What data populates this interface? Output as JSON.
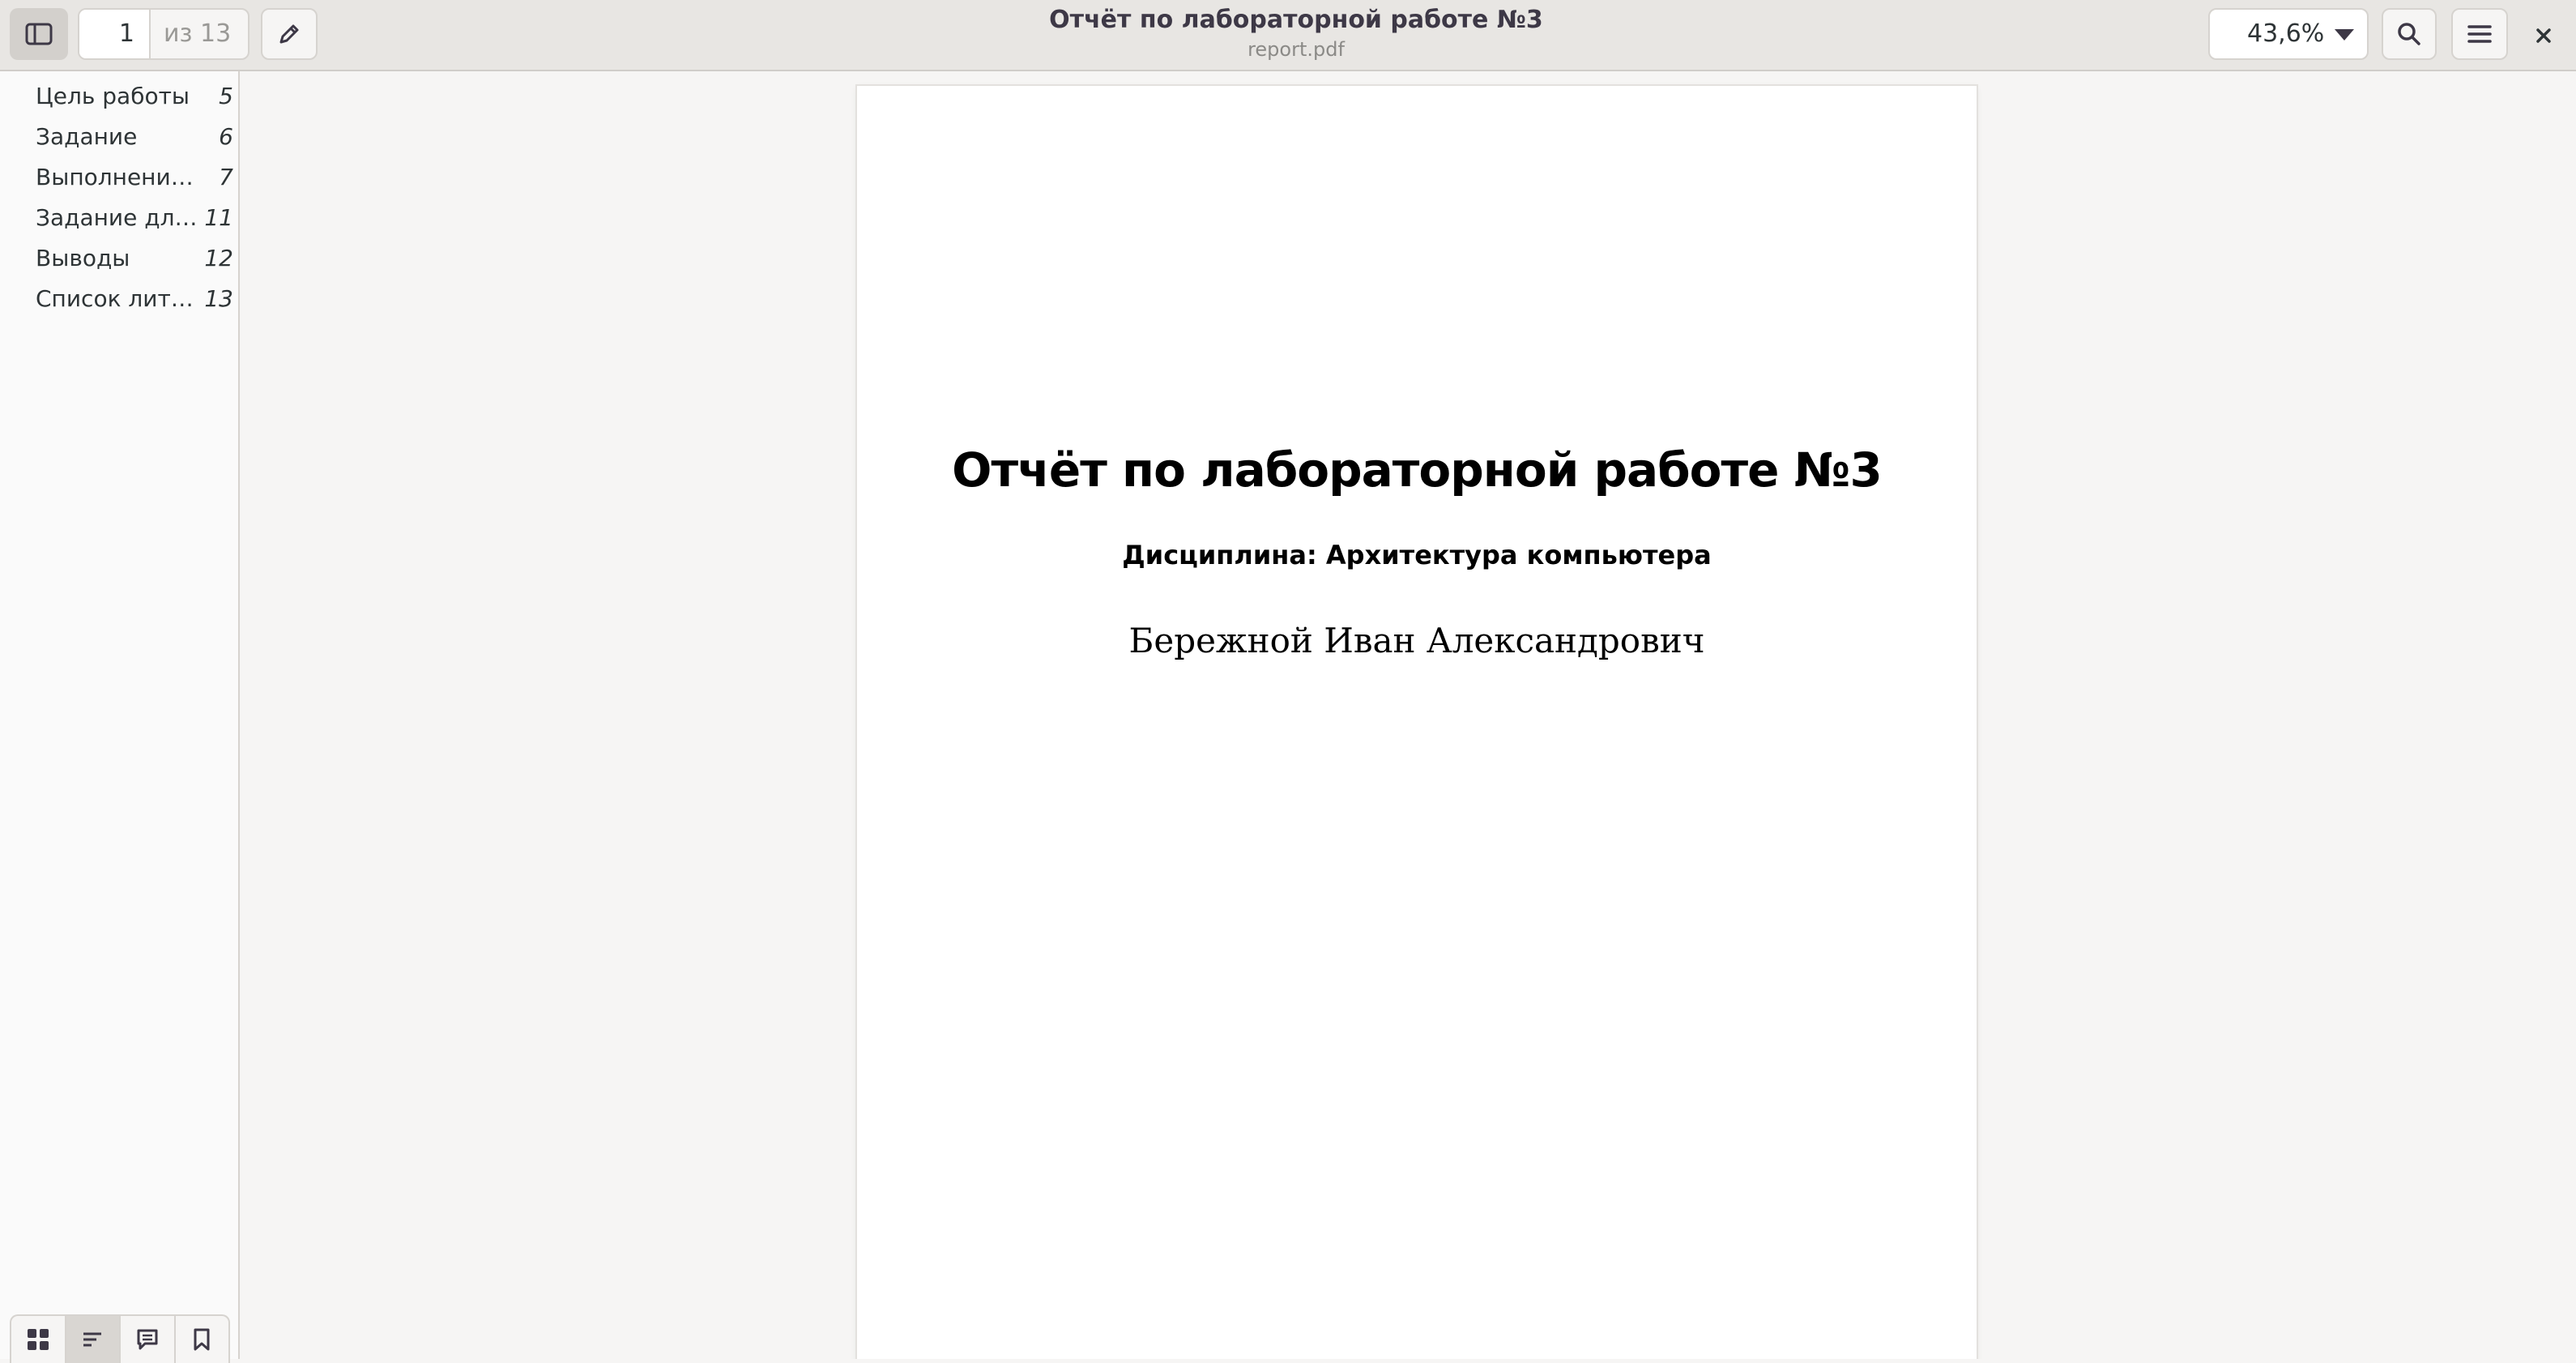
{
  "header": {
    "title": "Отчёт по лабораторной работе №3",
    "subtitle": "report.pdf",
    "page_current": "1",
    "page_total": "из 13",
    "zoom": "43,6%",
    "close_glyph": "×"
  },
  "sidebar": {
    "outline": [
      {
        "label": "Цель работы",
        "page": "5"
      },
      {
        "label": "Задание",
        "page": "6"
      },
      {
        "label": "Выполнение лабораторной работы",
        "page": "7"
      },
      {
        "label": "Задание для самостоятельной работы",
        "page": "11"
      },
      {
        "label": "Выводы",
        "page": "12"
      },
      {
        "label": "Список литературы",
        "page": "13"
      }
    ],
    "view_switcher": [
      "thumbnails-icon",
      "outline-icon",
      "annotations-icon",
      "bookmarks-icon"
    ],
    "active_view": "outline-icon"
  },
  "document": {
    "title": "Отчёт по лабораторной работе №3",
    "subject": "Дисциплина: Архитектура компьютера",
    "author": "Бережной Иван Александрович"
  },
  "colors": {
    "header_bg": "#e8e6e3",
    "sidebar_bg": "#fafafa",
    "canvas_bg": "#f6f5f4",
    "page_bg": "#ffffff"
  }
}
